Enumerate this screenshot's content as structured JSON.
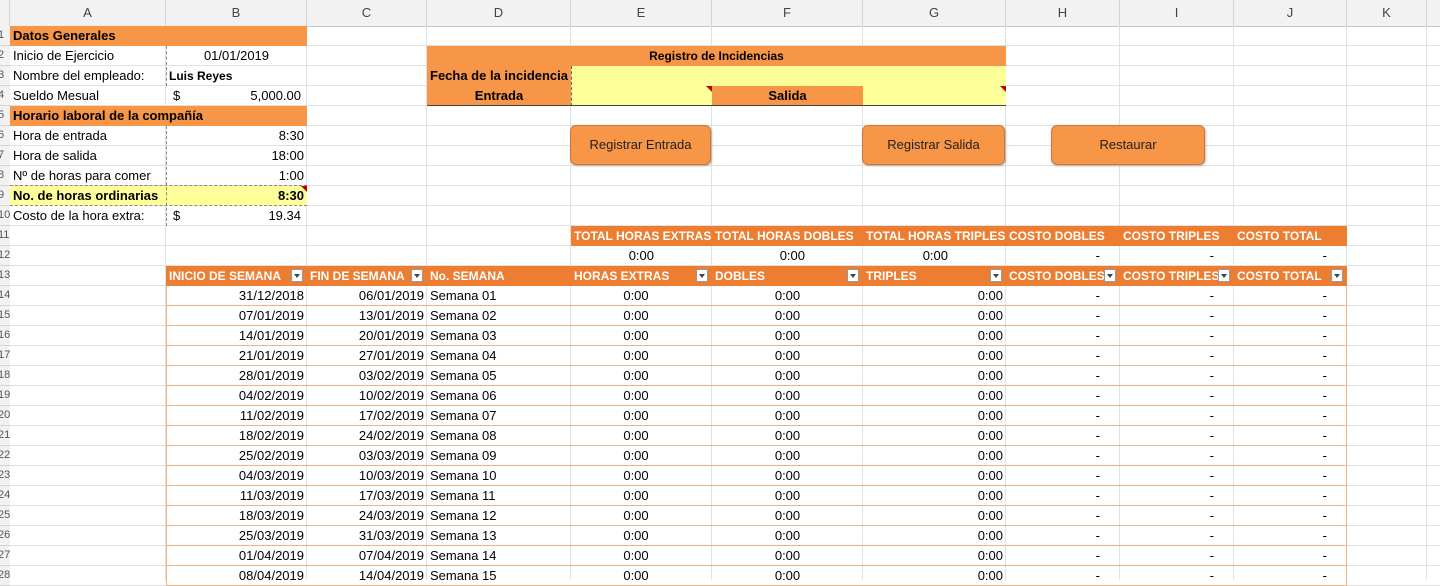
{
  "columns": [
    "A",
    "B",
    "C",
    "D",
    "E",
    "F",
    "G",
    "H",
    "I",
    "J",
    "K"
  ],
  "row_numbers": [
    "1",
    "2",
    "3",
    "4",
    "5",
    "6",
    "7",
    "8",
    "9",
    "10",
    "11",
    "12",
    "13",
    "14",
    "15",
    "16",
    "17",
    "18",
    "19",
    "20",
    "21",
    "22",
    "23",
    "24",
    "25",
    "26",
    "27",
    "28"
  ],
  "general": {
    "title": "Datos Generales",
    "inicio_label": "Inicio de Ejercicio",
    "inicio_value": "01/01/2019",
    "empleado_label": "Nombre del empleado:",
    "empleado_value": "Luis Reyes",
    "sueldo_label": "Sueldo Mesual",
    "sueldo_currency": "$",
    "sueldo_value": "5,000.00"
  },
  "horario": {
    "title": "Horario laboral de la compañía",
    "entrada_label": "Hora de entrada",
    "entrada_value": "8:30",
    "salida_label": "Hora de salida",
    "salida_value": "18:00",
    "comer_label": "Nº de horas para comer",
    "comer_value": "1:00",
    "ordinarias_label": "No. de horas ordinarias",
    "ordinarias_value": "8:30",
    "costo_label": "Costo de la hora extra:",
    "costo_currency": "$",
    "costo_value": "19.34"
  },
  "registro": {
    "title": "Registro de Incidencias",
    "fecha_label": "Fecha de la incidencia",
    "fecha_value": "",
    "entrada_label": "Entrada",
    "entrada_value": "",
    "salida_label": "Salida",
    "salida_value": ""
  },
  "buttons": {
    "registrar_entrada": "Registrar Entrada",
    "registrar_salida": "Registrar Salida",
    "restaurar": "Restaurar"
  },
  "totals": {
    "headers": [
      "TOTAL HORAS EXTRAS",
      "TOTAL HORAS DOBLES",
      "TOTAL HORAS TRIPLES",
      "COSTO DOBLES",
      "COSTO TRIPLES",
      "COSTO TOTAL"
    ],
    "values": [
      "0:00",
      "0:00",
      "0:00",
      "-",
      "-",
      "-"
    ]
  },
  "table": {
    "headers": [
      "INICIO DE SEMANA",
      "FIN DE SEMANA",
      "No. SEMANA",
      "HORAS EXTRAS",
      "DOBLES",
      "TRIPLES",
      "COSTO DOBLES",
      "COSTO TRIPLES",
      "COSTO TOTAL"
    ],
    "rows": [
      [
        "31/12/2018",
        "06/01/2019",
        "Semana 01",
        "0:00",
        "0:00",
        "0:00",
        "-",
        "-",
        "-"
      ],
      [
        "07/01/2019",
        "13/01/2019",
        "Semana 02",
        "0:00",
        "0:00",
        "0:00",
        "-",
        "-",
        "-"
      ],
      [
        "14/01/2019",
        "20/01/2019",
        "Semana 03",
        "0:00",
        "0:00",
        "0:00",
        "-",
        "-",
        "-"
      ],
      [
        "21/01/2019",
        "27/01/2019",
        "Semana 04",
        "0:00",
        "0:00",
        "0:00",
        "-",
        "-",
        "-"
      ],
      [
        "28/01/2019",
        "03/02/2019",
        "Semana 05",
        "0:00",
        "0:00",
        "0:00",
        "-",
        "-",
        "-"
      ],
      [
        "04/02/2019",
        "10/02/2019",
        "Semana 06",
        "0:00",
        "0:00",
        "0:00",
        "-",
        "-",
        "-"
      ],
      [
        "11/02/2019",
        "17/02/2019",
        "Semana 07",
        "0:00",
        "0:00",
        "0:00",
        "-",
        "-",
        "-"
      ],
      [
        "18/02/2019",
        "24/02/2019",
        "Semana 08",
        "0:00",
        "0:00",
        "0:00",
        "-",
        "-",
        "-"
      ],
      [
        "25/02/2019",
        "03/03/2019",
        "Semana 09",
        "0:00",
        "0:00",
        "0:00",
        "-",
        "-",
        "-"
      ],
      [
        "04/03/2019",
        "10/03/2019",
        "Semana 10",
        "0:00",
        "0:00",
        "0:00",
        "-",
        "-",
        "-"
      ],
      [
        "11/03/2019",
        "17/03/2019",
        "Semana 11",
        "0:00",
        "0:00",
        "0:00",
        "-",
        "-",
        "-"
      ],
      [
        "18/03/2019",
        "24/03/2019",
        "Semana 12",
        "0:00",
        "0:00",
        "0:00",
        "-",
        "-",
        "-"
      ],
      [
        "25/03/2019",
        "31/03/2019",
        "Semana 13",
        "0:00",
        "0:00",
        "0:00",
        "-",
        "-",
        "-"
      ],
      [
        "01/04/2019",
        "07/04/2019",
        "Semana 14",
        "0:00",
        "0:00",
        "0:00",
        "-",
        "-",
        "-"
      ],
      [
        "08/04/2019",
        "14/04/2019",
        "Semana 15",
        "0:00",
        "0:00",
        "0:00",
        "-",
        "-",
        "-"
      ]
    ]
  }
}
